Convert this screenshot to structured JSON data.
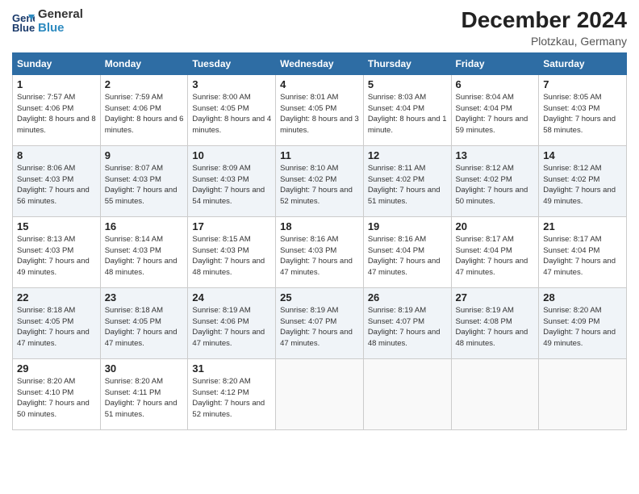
{
  "header": {
    "logo_line1": "General",
    "logo_line2": "Blue",
    "month": "December 2024",
    "location": "Plotzkau, Germany"
  },
  "days_of_week": [
    "Sunday",
    "Monday",
    "Tuesday",
    "Wednesday",
    "Thursday",
    "Friday",
    "Saturday"
  ],
  "weeks": [
    [
      {
        "day": "1",
        "sunrise": "7:57 AM",
        "sunset": "4:06 PM",
        "daylight": "8 hours and 8 minutes."
      },
      {
        "day": "2",
        "sunrise": "7:59 AM",
        "sunset": "4:06 PM",
        "daylight": "8 hours and 6 minutes."
      },
      {
        "day": "3",
        "sunrise": "8:00 AM",
        "sunset": "4:05 PM",
        "daylight": "8 hours and 4 minutes."
      },
      {
        "day": "4",
        "sunrise": "8:01 AM",
        "sunset": "4:05 PM",
        "daylight": "8 hours and 3 minutes."
      },
      {
        "day": "5",
        "sunrise": "8:03 AM",
        "sunset": "4:04 PM",
        "daylight": "8 hours and 1 minute."
      },
      {
        "day": "6",
        "sunrise": "8:04 AM",
        "sunset": "4:04 PM",
        "daylight": "7 hours and 59 minutes."
      },
      {
        "day": "7",
        "sunrise": "8:05 AM",
        "sunset": "4:03 PM",
        "daylight": "7 hours and 58 minutes."
      }
    ],
    [
      {
        "day": "8",
        "sunrise": "8:06 AM",
        "sunset": "4:03 PM",
        "daylight": "7 hours and 56 minutes."
      },
      {
        "day": "9",
        "sunrise": "8:07 AM",
        "sunset": "4:03 PM",
        "daylight": "7 hours and 55 minutes."
      },
      {
        "day": "10",
        "sunrise": "8:09 AM",
        "sunset": "4:03 PM",
        "daylight": "7 hours and 54 minutes."
      },
      {
        "day": "11",
        "sunrise": "8:10 AM",
        "sunset": "4:02 PM",
        "daylight": "7 hours and 52 minutes."
      },
      {
        "day": "12",
        "sunrise": "8:11 AM",
        "sunset": "4:02 PM",
        "daylight": "7 hours and 51 minutes."
      },
      {
        "day": "13",
        "sunrise": "8:12 AM",
        "sunset": "4:02 PM",
        "daylight": "7 hours and 50 minutes."
      },
      {
        "day": "14",
        "sunrise": "8:12 AM",
        "sunset": "4:02 PM",
        "daylight": "7 hours and 49 minutes."
      }
    ],
    [
      {
        "day": "15",
        "sunrise": "8:13 AM",
        "sunset": "4:03 PM",
        "daylight": "7 hours and 49 minutes."
      },
      {
        "day": "16",
        "sunrise": "8:14 AM",
        "sunset": "4:03 PM",
        "daylight": "7 hours and 48 minutes."
      },
      {
        "day": "17",
        "sunrise": "8:15 AM",
        "sunset": "4:03 PM",
        "daylight": "7 hours and 48 minutes."
      },
      {
        "day": "18",
        "sunrise": "8:16 AM",
        "sunset": "4:03 PM",
        "daylight": "7 hours and 47 minutes."
      },
      {
        "day": "19",
        "sunrise": "8:16 AM",
        "sunset": "4:04 PM",
        "daylight": "7 hours and 47 minutes."
      },
      {
        "day": "20",
        "sunrise": "8:17 AM",
        "sunset": "4:04 PM",
        "daylight": "7 hours and 47 minutes."
      },
      {
        "day": "21",
        "sunrise": "8:17 AM",
        "sunset": "4:04 PM",
        "daylight": "7 hours and 47 minutes."
      }
    ],
    [
      {
        "day": "22",
        "sunrise": "8:18 AM",
        "sunset": "4:05 PM",
        "daylight": "7 hours and 47 minutes."
      },
      {
        "day": "23",
        "sunrise": "8:18 AM",
        "sunset": "4:05 PM",
        "daylight": "7 hours and 47 minutes."
      },
      {
        "day": "24",
        "sunrise": "8:19 AM",
        "sunset": "4:06 PM",
        "daylight": "7 hours and 47 minutes."
      },
      {
        "day": "25",
        "sunrise": "8:19 AM",
        "sunset": "4:07 PM",
        "daylight": "7 hours and 47 minutes."
      },
      {
        "day": "26",
        "sunrise": "8:19 AM",
        "sunset": "4:07 PM",
        "daylight": "7 hours and 48 minutes."
      },
      {
        "day": "27",
        "sunrise": "8:19 AM",
        "sunset": "4:08 PM",
        "daylight": "7 hours and 48 minutes."
      },
      {
        "day": "28",
        "sunrise": "8:20 AM",
        "sunset": "4:09 PM",
        "daylight": "7 hours and 49 minutes."
      }
    ],
    [
      {
        "day": "29",
        "sunrise": "8:20 AM",
        "sunset": "4:10 PM",
        "daylight": "7 hours and 50 minutes."
      },
      {
        "day": "30",
        "sunrise": "8:20 AM",
        "sunset": "4:11 PM",
        "daylight": "7 hours and 51 minutes."
      },
      {
        "day": "31",
        "sunrise": "8:20 AM",
        "sunset": "4:12 PM",
        "daylight": "7 hours and 52 minutes."
      },
      null,
      null,
      null,
      null
    ]
  ]
}
